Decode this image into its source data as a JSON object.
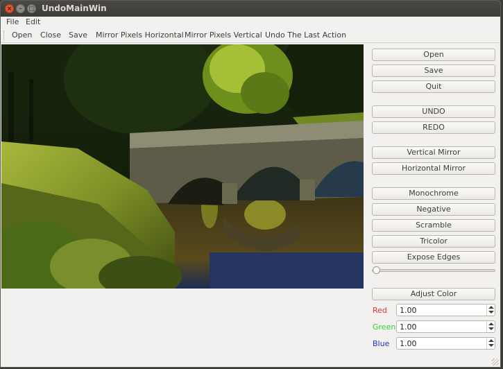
{
  "window": {
    "title": "UndoMainWin"
  },
  "menubar": {
    "items": [
      "File",
      "Edit"
    ]
  },
  "toolbar": {
    "items": [
      "Open",
      "Close",
      "Save",
      "Mirror Pixels Horizontal",
      "Mirror Pixels Vertical",
      "Undo The Last Action"
    ]
  },
  "image": {
    "description_icon": "photo-image"
  },
  "side_buttons": {
    "open": "Open",
    "save": "Save",
    "quit": "Quit",
    "undo": "UNDO",
    "redo": "REDO",
    "vertical_mirror": "Vertical Mirror",
    "horizontal_mirror": "Horizontal Mirror",
    "monochrome": "Monochrome",
    "negative": "Negative",
    "scramble": "Scramble",
    "tricolor": "Tricolor",
    "expose_edges": "Expose Edges",
    "adjust_color": "Adjust Color"
  },
  "slider": {
    "value": 0
  },
  "color": {
    "red": {
      "label": "Red",
      "value": "1.00",
      "color": "#e03030"
    },
    "green": {
      "label": "Green",
      "value": "1.00",
      "color": "#30d030"
    },
    "blue": {
      "label": "Blue",
      "value": "1.00",
      "color": "#2030c0"
    }
  }
}
